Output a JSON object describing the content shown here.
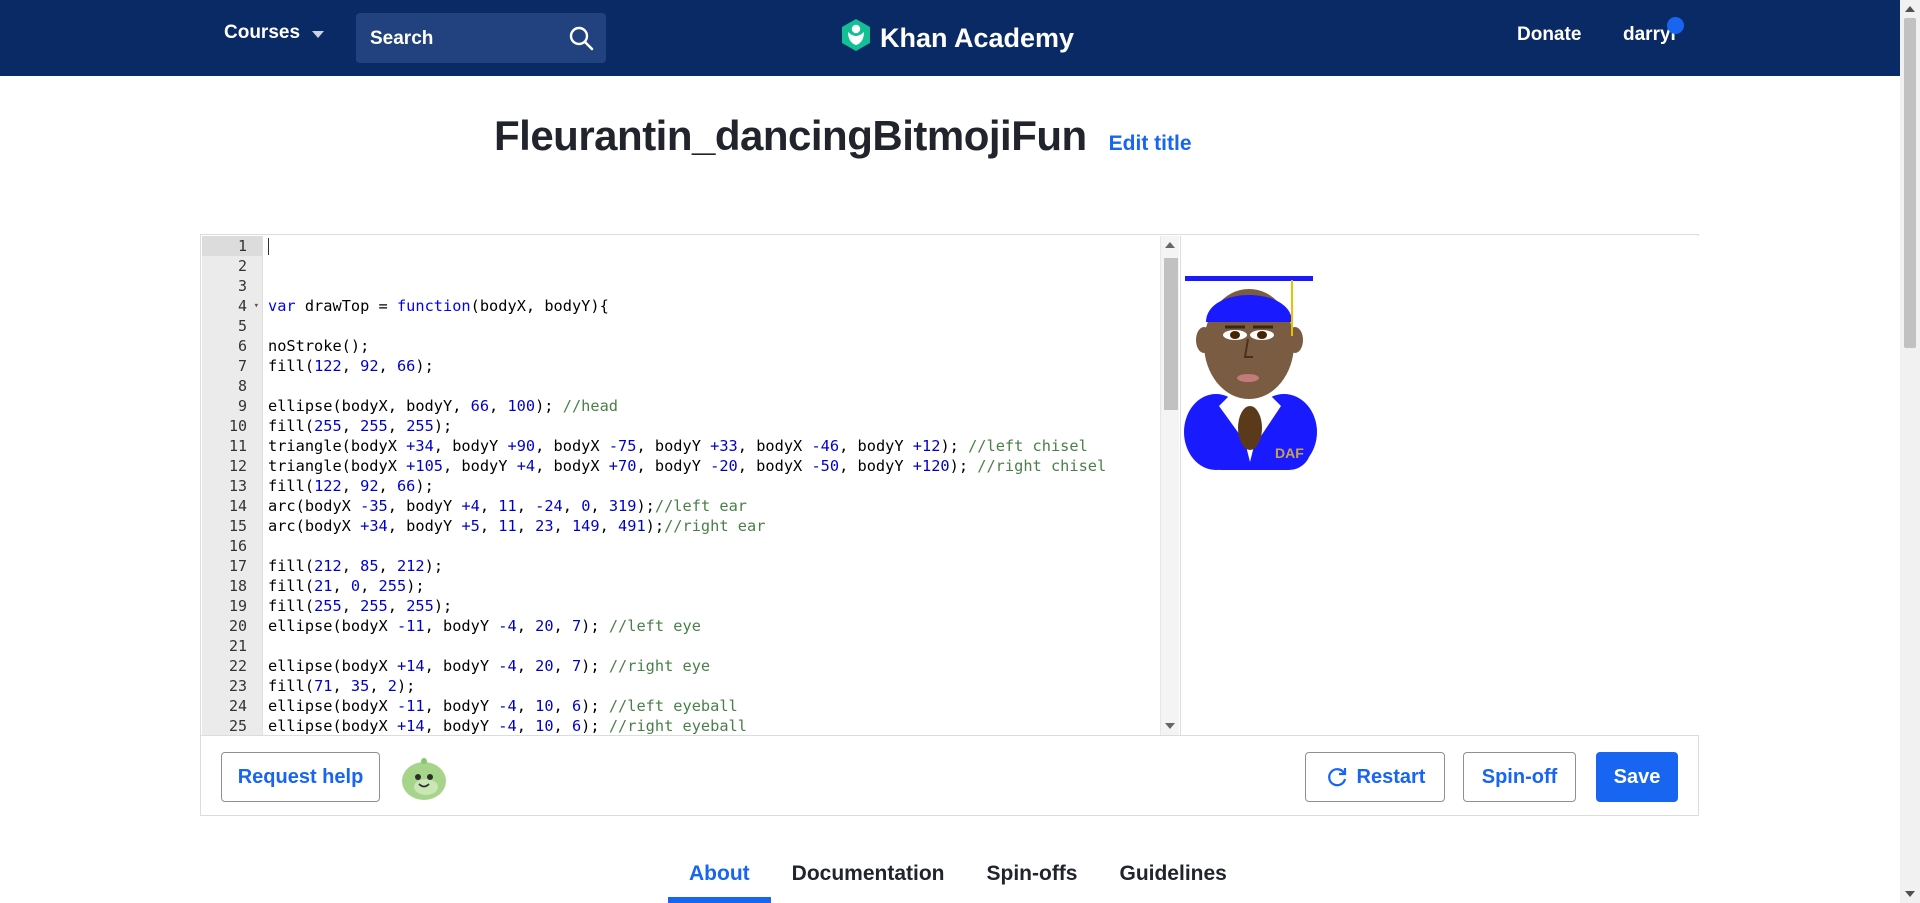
{
  "header": {
    "courses_label": "Courses",
    "search_placeholder": "Search",
    "logo_text": "Khan Academy",
    "donate_label": "Donate",
    "username": "darryl"
  },
  "project": {
    "title": "Fleurantin_dancingBitmojiFun",
    "edit_title_label": "Edit title"
  },
  "editor": {
    "line_numbers": [
      "1",
      "2",
      "3",
      "4",
      "5",
      "6",
      "7",
      "8",
      "9",
      "10",
      "11",
      "12",
      "13",
      "14",
      "15",
      "16",
      "17",
      "18",
      "19",
      "20",
      "21",
      "22",
      "23",
      "24",
      "25"
    ],
    "fold_marker": "▾",
    "lines": [
      "",
      "",
      "",
      "var drawTop = function(bodyX, bodyY){",
      "",
      "noStroke();",
      "fill(122, 92, 66);",
      "",
      "ellipse(bodyX, bodyY, 66, 100); //head",
      "fill(255, 255, 255);",
      "triangle(bodyX +34, bodyY +90, bodyX -75, bodyY +33, bodyX -46, bodyY +12); //left chisel",
      "triangle(bodyX +105, bodyY +4, bodyX +70, bodyY -20, bodyX -50, bodyY +120); //right chisel",
      "fill(122, 92, 66);",
      "arc(bodyX -35, bodyY +4, 11, -24, 0, 319);//left ear",
      "arc(bodyX +34, bodyY +5, 11, 23, 149, 491);//right ear",
      "",
      "fill(212, 85, 212);",
      "fill(21, 0, 255);",
      "fill(255, 255, 255);",
      "ellipse(bodyX -11, bodyY -4, 20, 7); //left eye",
      "",
      "ellipse(bodyX +14, bodyY -4, 20, 7); //right eye",
      "fill(71, 35, 2);",
      "ellipse(bodyX -11, bodyY -4, 10, 6); //left eyeball",
      "ellipse(bodyX +14, bodyY -4, 10, 6); //right eyeball"
    ]
  },
  "canvas": {
    "shirt_text": "DAF"
  },
  "actions": {
    "request_help": "Request help",
    "restart": "Restart",
    "spinoff": "Spin-off",
    "save": "Save"
  },
  "tabs": {
    "about": "About",
    "documentation": "Documentation",
    "spinoffs": "Spin-offs",
    "guidelines": "Guidelines"
  },
  "colors": {
    "header_bg": "#0a2a66",
    "accent": "#1865f2",
    "logo_green": "#14bf96"
  }
}
